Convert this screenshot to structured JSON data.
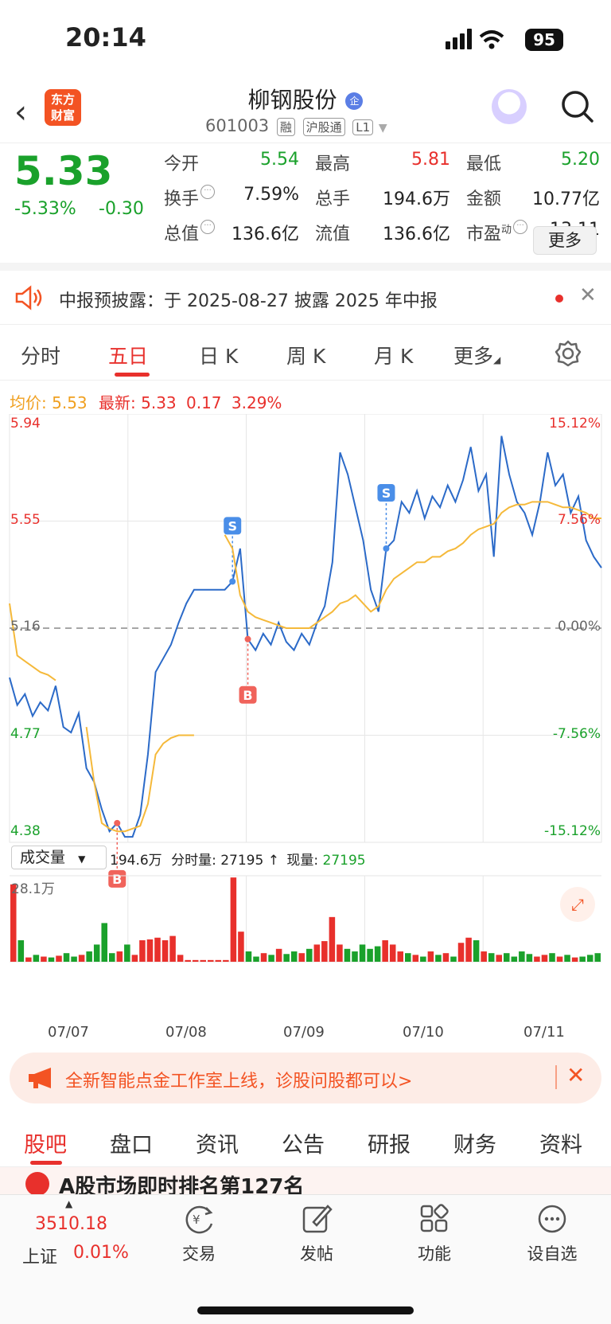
{
  "status_bar": {
    "time": "20:14",
    "battery": "95"
  },
  "header": {
    "logo_line1": "东方",
    "logo_line2": "财富",
    "stock_name": "柳钢股份",
    "name_badge": "企",
    "stock_code": "601003",
    "tags": [
      "融",
      "沪股通",
      "L1"
    ]
  },
  "quote": {
    "price": "5.33",
    "change_pct": "-5.33%",
    "change": "-0.30",
    "rows": [
      [
        {
          "label": "今开",
          "value": "5.54",
          "color": "#1aa12b"
        },
        {
          "label": "最高",
          "value": "5.81",
          "color": "#e8302c"
        },
        {
          "label": "最低",
          "value": "5.20",
          "color": "#1aa12b"
        }
      ],
      [
        {
          "label": "换手",
          "value": "7.59%",
          "color": "#222",
          "info": true
        },
        {
          "label": "总手",
          "value": "194.6万",
          "color": "#222"
        },
        {
          "label": "金额",
          "value": "10.77亿",
          "color": "#222"
        }
      ],
      [
        {
          "label": "总值",
          "value": "136.6亿",
          "color": "#222",
          "info": true
        },
        {
          "label": "流值",
          "value": "136.6亿",
          "color": "#222"
        },
        {
          "label": "市盈",
          "sup": "动",
          "value": "13.11",
          "color": "#222",
          "info": true
        }
      ]
    ],
    "more_label": "更多"
  },
  "notice": {
    "text": "中报预披露：于 2025-08-27 披露 2025 年中报"
  },
  "chart_tabs": [
    "分时",
    "五日",
    "日 K",
    "周 K",
    "月 K",
    "更多"
  ],
  "avg_line": {
    "avg_label": "均价:",
    "avg_value": "5.53",
    "latest_label": "最新:",
    "latest_value": "5.33",
    "chg": "0.17",
    "chg_pct": "3.29%"
  },
  "chart_data": {
    "type": "line",
    "title": "",
    "y_left_ticks": [
      "5.94",
      "5.55",
      "5.16",
      "4.77",
      "4.38"
    ],
    "y_right_ticks": [
      "15.12%",
      "7.56%",
      "0.00%",
      "-7.56%",
      "-15.12%"
    ],
    "ylim": [
      4.38,
      5.94
    ],
    "x_dates": [
      "07/07",
      "07/08",
      "07/09",
      "07/10",
      "07/11"
    ],
    "price_series": [
      4.98,
      4.88,
      4.92,
      4.84,
      4.89,
      4.86,
      4.95,
      4.8,
      4.78,
      4.85,
      4.65,
      4.6,
      4.5,
      4.42,
      4.45,
      4.4,
      4.4,
      4.48,
      4.7,
      5.0,
      5.05,
      5.1,
      5.18,
      5.25,
      5.3,
      5.3,
      5.3,
      5.3,
      5.3,
      5.33,
      5.45,
      5.12,
      5.08,
      5.14,
      5.1,
      5.18,
      5.11,
      5.08,
      5.14,
      5.1,
      5.18,
      5.24,
      5.4,
      5.8,
      5.72,
      5.6,
      5.48,
      5.3,
      5.22,
      5.45,
      5.48,
      5.62,
      5.58,
      5.66,
      5.56,
      5.64,
      5.6,
      5.68,
      5.62,
      5.7,
      5.82,
      5.66,
      5.72,
      5.42,
      5.86,
      5.72,
      5.62,
      5.58,
      5.5,
      5.62,
      5.8,
      5.68,
      5.72,
      5.58,
      5.64,
      5.48,
      5.42,
      5.38
    ],
    "avg_series": [
      5.25,
      5.06,
      5.04,
      5.02,
      5.0,
      4.99,
      4.97,
      null,
      null,
      null,
      4.8,
      4.6,
      4.45,
      4.43,
      4.42,
      4.42,
      4.43,
      4.44,
      4.52,
      4.7,
      4.74,
      4.76,
      4.77,
      4.77,
      4.77,
      null,
      null,
      null,
      5.5,
      5.45,
      5.28,
      5.22,
      5.2,
      5.19,
      5.18,
      5.17,
      5.16,
      5.16,
      5.16,
      5.16,
      5.18,
      5.2,
      5.22,
      5.25,
      5.26,
      5.28,
      5.25,
      5.22,
      5.24,
      5.3,
      5.34,
      5.36,
      5.38,
      5.4,
      5.4,
      5.42,
      5.42,
      5.44,
      5.45,
      5.47,
      5.5,
      5.52,
      5.53,
      5.54,
      5.58,
      5.6,
      5.61,
      5.61,
      5.62,
      5.62,
      5.62,
      5.61,
      5.6,
      5.6,
      5.59,
      5.58,
      5.56,
      5.56
    ],
    "markers": [
      {
        "label": "B",
        "type": "buy",
        "x_index": 14,
        "price": 4.45
      },
      {
        "label": "S",
        "type": "sell",
        "x_index": 29,
        "price": 5.33
      },
      {
        "label": "B",
        "type": "buy",
        "x_index": 31,
        "price": 5.12
      },
      {
        "label": "S",
        "type": "sell",
        "x_index": 49,
        "price": 5.45
      }
    ],
    "volume": {
      "label": "成交量",
      "total": "194.6万",
      "minute_label": "分时量:",
      "minute_value": "27195",
      "arrow": "↑",
      "now_label": "现量:",
      "now_value": "27195",
      "max_label": "28.1万",
      "bars": [
        0.9,
        0.25,
        0.05,
        0.08,
        0.06,
        0.05,
        0.07,
        0.1,
        0.06,
        0.08,
        0.12,
        0.2,
        0.45,
        0.1,
        0.12,
        0.2,
        0.08,
        0.25,
        0.26,
        0.28,
        0.25,
        0.3,
        0.08,
        0.02,
        0.02,
        0.02,
        0.02,
        0.02,
        0.02,
        0.98,
        0.35,
        0.12,
        0.06,
        0.1,
        0.08,
        0.15,
        0.09,
        0.12,
        0.1,
        0.15,
        0.2,
        0.24,
        0.52,
        0.2,
        0.15,
        0.12,
        0.2,
        0.15,
        0.18,
        0.25,
        0.2,
        0.12,
        0.1,
        0.08,
        0.06,
        0.12,
        0.08,
        0.1,
        0.06,
        0.22,
        0.28,
        0.25,
        0.12,
        0.1,
        0.08,
        0.1,
        0.06,
        0.12,
        0.09,
        0.06,
        0.08,
        0.1,
        0.06,
        0.08,
        0.05,
        0.06,
        0.08,
        0.1
      ]
    }
  },
  "promo": {
    "text": "全新智能点金工作室上线，诊股问股都可以>"
  },
  "bottom_tabs": [
    "股吧",
    "盘口",
    "资讯",
    "公告",
    "研报",
    "财务",
    "资料"
  ],
  "peek": {
    "text": "A股市场即时排名第127名"
  },
  "tabbar": {
    "index_value": "3510.18",
    "index_name": "上证",
    "index_pct": "0.01%",
    "items": [
      {
        "label": "交易",
        "icon": "trade-icon"
      },
      {
        "label": "发帖",
        "icon": "post-icon"
      },
      {
        "label": "功能",
        "icon": "function-icon"
      },
      {
        "label": "设自选",
        "icon": "more-icon"
      }
    ]
  }
}
